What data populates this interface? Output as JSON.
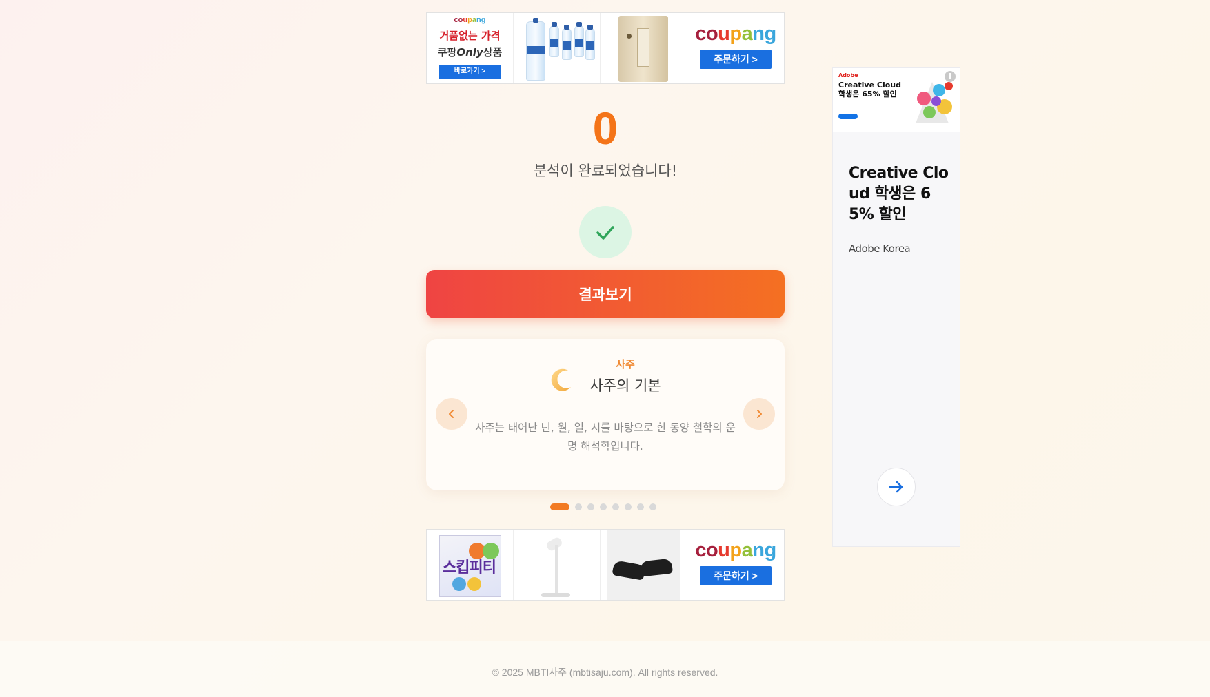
{
  "top_banner": {
    "promo_logo": "coupang",
    "promo_title": "거품없는 가격",
    "promo_sub_prefix": "쿠팡",
    "promo_sub_italic": "Only",
    "promo_sub_suffix": "상품",
    "promo_button": "바로가기 >",
    "brand_letters": [
      "c",
      "o",
      "u",
      "p",
      "a",
      "n",
      "g"
    ],
    "order_button": "주문하기 >"
  },
  "result": {
    "count": "0",
    "message": "분석이 완료되었습니다!",
    "button_label": "결과보기"
  },
  "carousel": {
    "category": "사주",
    "title": "사주의 기본",
    "description": "사주는 태어난 년, 월, 일, 시를 바탕으로 한 동양 철학의 운명 해석학입니다.",
    "slide_count": 8,
    "active_index": 0,
    "prev_icon": "chevron-left-icon",
    "next_icon": "chevron-right-icon"
  },
  "bottom_banner": {
    "product_text": "스킵피티",
    "brand_letters": [
      "c",
      "o",
      "u",
      "p",
      "a",
      "n",
      "g"
    ],
    "order_button": "주문하기 >"
  },
  "side_ad": {
    "image_brand": "Adobe",
    "image_headline": "Creative Cloud 학생은 65% 할인",
    "info_icon": "i",
    "headline": "Creative Cloud 학생은 65% 할인",
    "advertiser": "Adobe Korea"
  },
  "footer": {
    "copyright": "© 2025 MBTI사주 (mbtisaju.com). All rights reserved."
  },
  "colors": {
    "accent_orange": "#f47418",
    "button_gradient_start": "#ef4443",
    "button_gradient_end": "#f47022",
    "check_bg": "#dcf5e4",
    "check_color": "#2fa55a",
    "coupang_blue": "#1a6fe0"
  }
}
